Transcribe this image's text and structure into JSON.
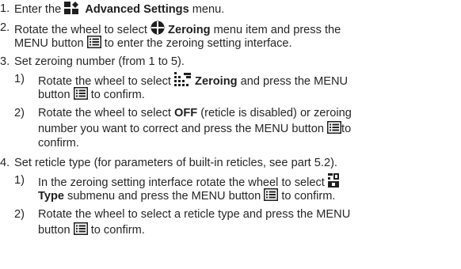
{
  "steps": [
    {
      "num": "1.",
      "pre": "Enter the ",
      "icon": "advanced-settings-icon",
      "bold": "Advanced Settings",
      "post": " menu."
    },
    {
      "num": "2.",
      "line1_pre": "Rotate the wheel to select ",
      "icon": "crosshair-icon",
      "bold": "Zeroing",
      "line1_post": " menu item and press the",
      "line2_pre": "MENU button ",
      "menu_icon": "menu-button-icon",
      "line2_post": " to enter the zeroing setting interface."
    },
    {
      "num": "3.",
      "text": "Set zeroing number (from 1 to 5).",
      "sub": [
        {
          "num": "1)",
          "line1_pre": "Rotate the wheel to select ",
          "icon": "zeroing-grid-icon",
          "bold": "Zeroing",
          "line1_post": " and press the MENU",
          "line2_pre": "button ",
          "menu_icon": "menu-button-icon",
          "line2_post": " to confirm."
        },
        {
          "num": "2)",
          "line1_pre": "Rotate the wheel to select ",
          "bold": "OFF",
          "line1_post": " (reticle is disabled) or zeroing",
          "line2_pre": "number you want to correct and press the MENU button ",
          "menu_icon": "menu-button-icon",
          "line2_post": "to",
          "line3": "confirm."
        }
      ]
    },
    {
      "num": "4.",
      "text": "Set reticle type (for parameters of built-in reticles, see part 5.2).",
      "sub": [
        {
          "num": "1)",
          "line1_text": "In the zeroing setting interface rotate the wheel to select",
          "icon": "reticle-type-icon",
          "line2_bold": "Type",
          "line2_mid": " submenu and press the MENU button ",
          "menu_icon": "menu-button-icon",
          "line2_post": " to confirm."
        },
        {
          "num": "2)",
          "line1_text": "Rotate the wheel to select a reticle type and press the MENU",
          "line2_pre": "button ",
          "menu_icon": "menu-button-icon",
          "line2_post": " to confirm."
        }
      ]
    }
  ],
  "colors": {
    "text": "#262626",
    "icon": "#1f1f1f"
  }
}
